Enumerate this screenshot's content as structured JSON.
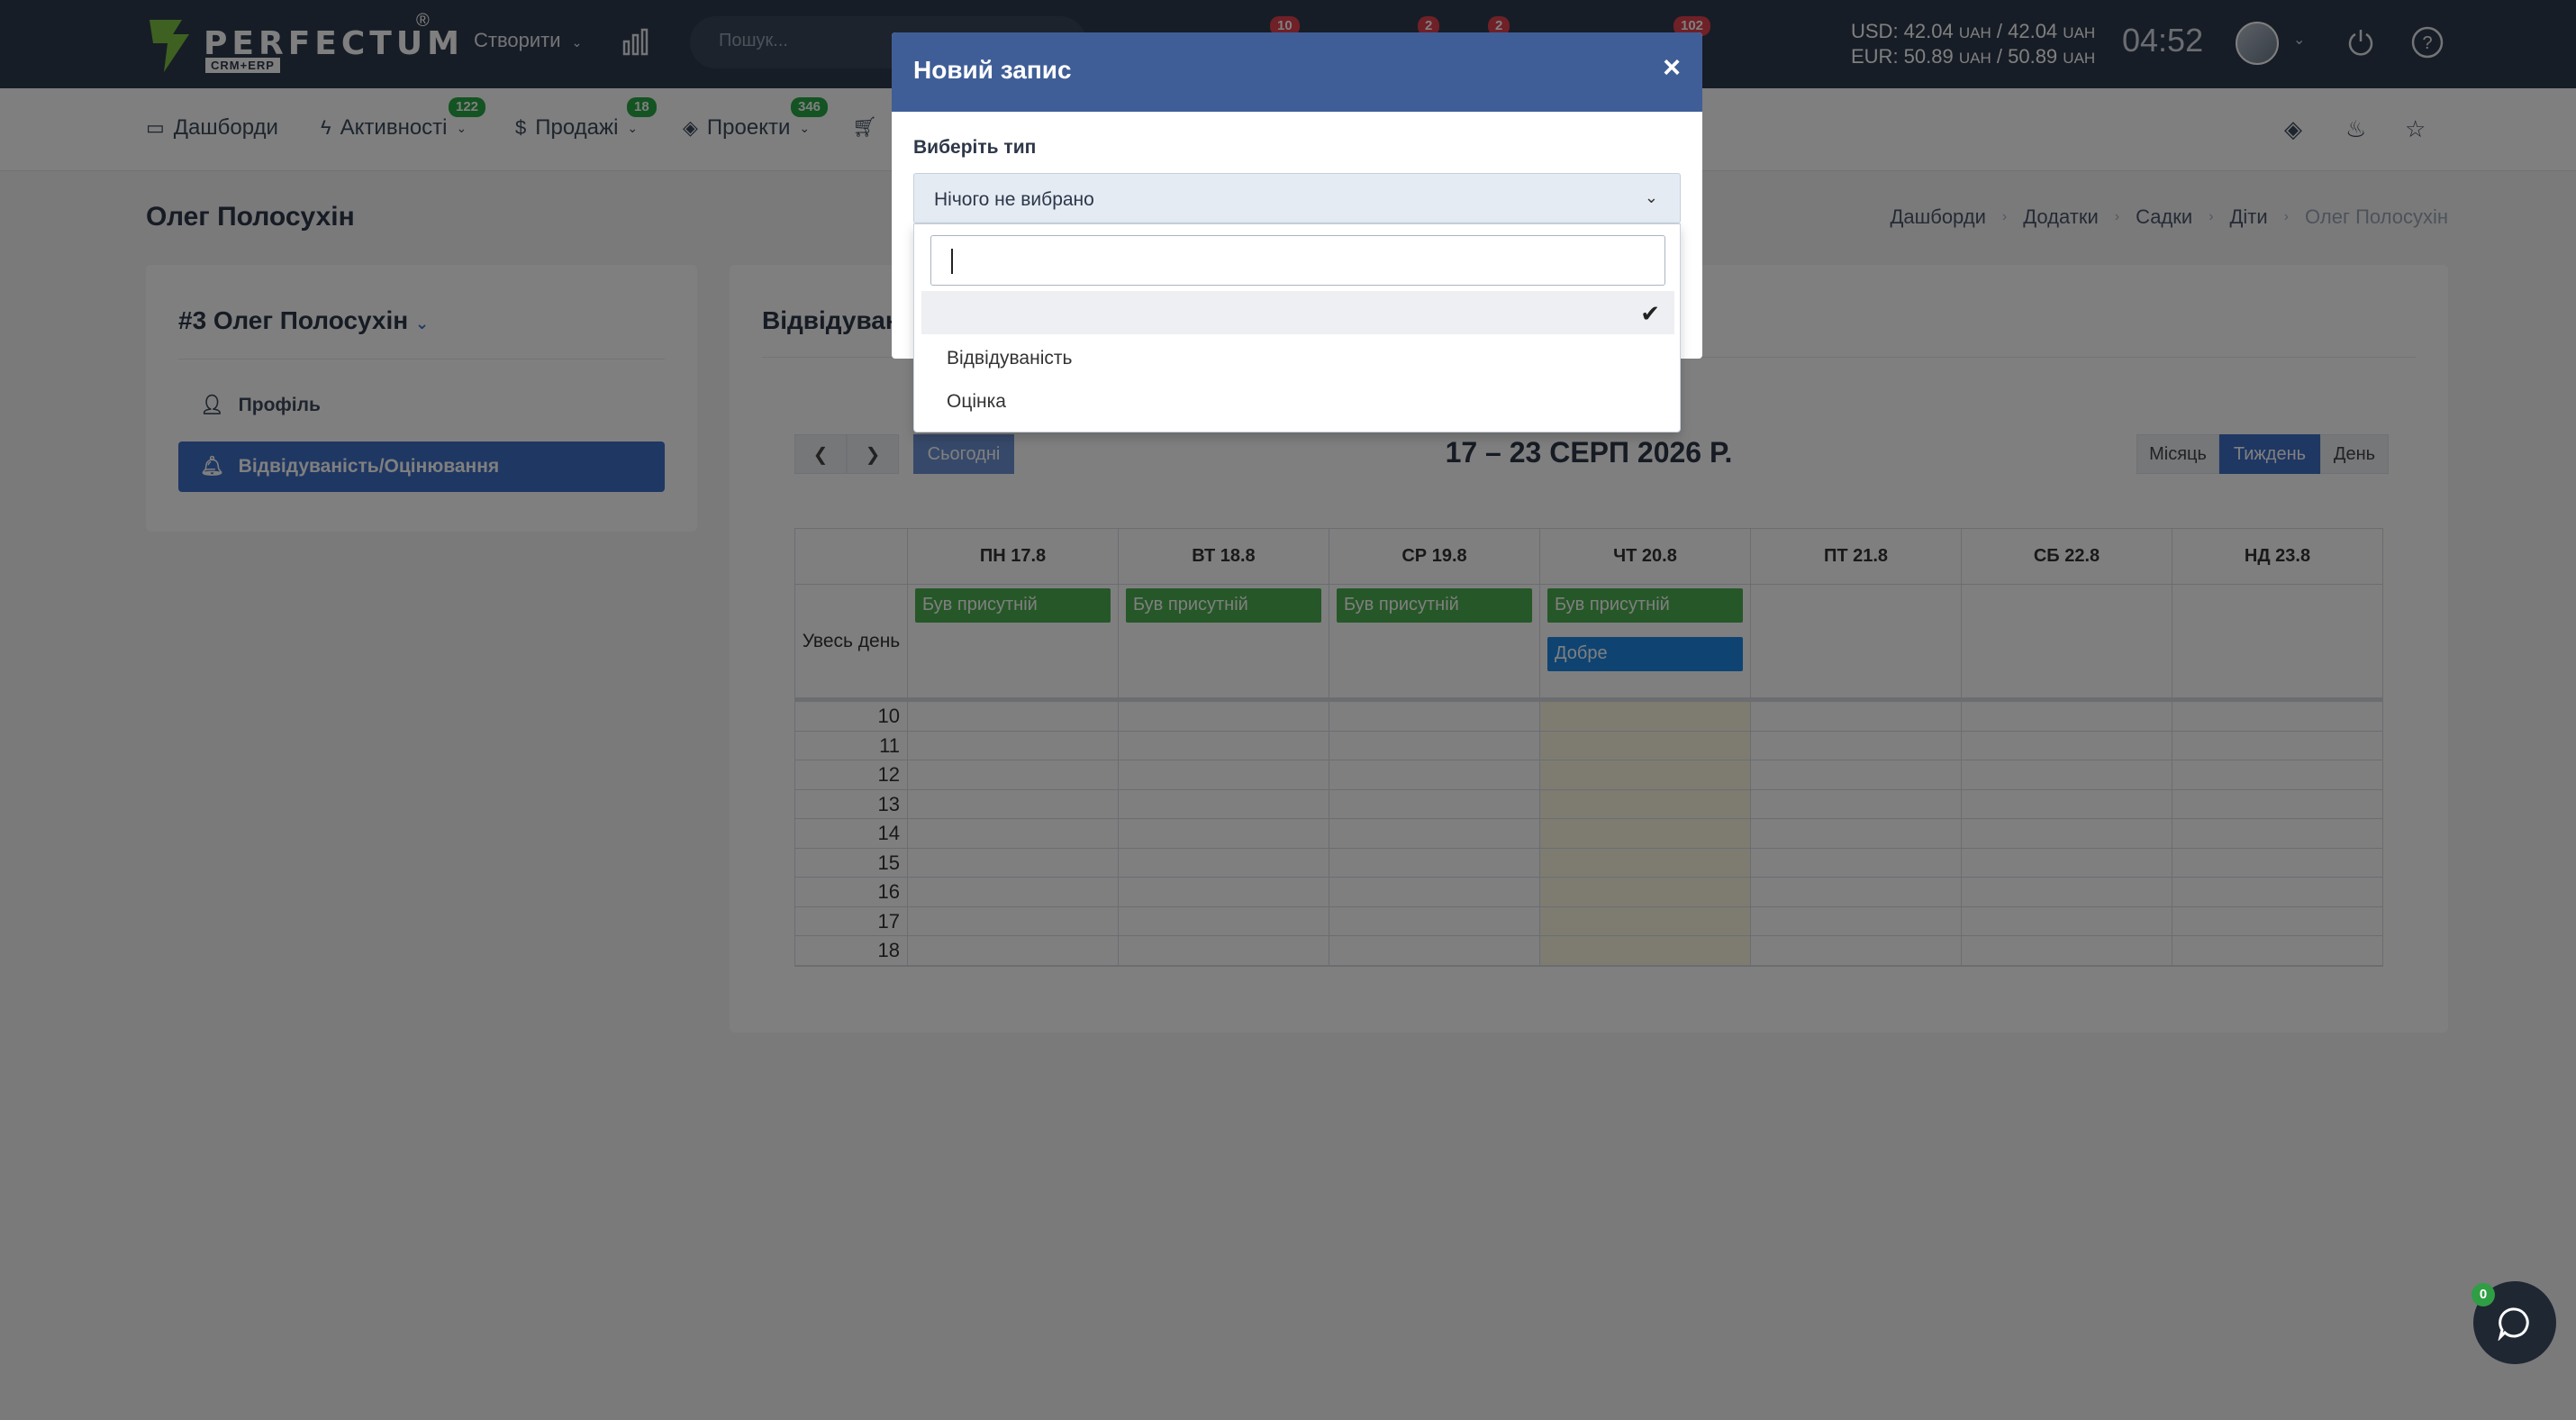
{
  "header": {
    "logo_text": "PERFECTUM",
    "logo_sub": "CRM+ERP",
    "logo_reg": "®",
    "create_label": "Створити",
    "search_placeholder": "Пошук...",
    "badges": [
      "10",
      "2",
      "2",
      "102"
    ],
    "currency_usd": "USD: 42.04",
    "currency_usd_mid": "/ 42.04",
    "currency_eur": "EUR: 50.89",
    "currency_eur_mid": "/ 50.89",
    "currency_unit": "UAH",
    "clock": "04:52"
  },
  "menu": {
    "items": [
      {
        "label": "Дашборди",
        "icon": "monitor-icon",
        "badge": ""
      },
      {
        "label": "Активності",
        "icon": "bolt-icon",
        "badge": "122"
      },
      {
        "label": "Продажі",
        "icon": "dollar-icon",
        "badge": "18"
      },
      {
        "label": "Проекти",
        "icon": "layers-icon",
        "badge": "346"
      }
    ]
  },
  "page": {
    "title": "Олег Полосухін",
    "breadcrumbs": [
      "Дашборди",
      "Додатки",
      "Садки",
      "Діти",
      "Олег Полосухін"
    ]
  },
  "left_card": {
    "heading": "#3 Олег Полосухін",
    "links": [
      "Профіль",
      "Відвідуваність/Оцінювання"
    ]
  },
  "right_card": {
    "heading": "Відвідувані",
    "today_label": "Сьогодні",
    "range_title": "17 – 23 СЕРП 2026 Р.",
    "views": [
      "Місяць",
      "Тиждень",
      "День"
    ],
    "days": [
      "ПН 17.8",
      "ВТ 18.8",
      "СР 19.8",
      "ЧТ 20.8",
      "ПТ 21.8",
      "СБ 22.8",
      "НД 23.8"
    ],
    "allday_label": "Увесь день",
    "events": [
      {
        "day": 0,
        "row": 0,
        "title": "Був присутній",
        "color": "#4caf50"
      },
      {
        "day": 1,
        "row": 0,
        "title": "Був присутній",
        "color": "#4caf50"
      },
      {
        "day": 2,
        "row": 0,
        "title": "Був присутній",
        "color": "#4caf50"
      },
      {
        "day": 3,
        "row": 0,
        "title": "Був присутній",
        "color": "#4caf50"
      },
      {
        "day": 3,
        "row": 1,
        "title": "Добре",
        "color": "#1e88e5"
      }
    ],
    "hours": [
      "10",
      "11",
      "12",
      "13",
      "14",
      "15",
      "16",
      "17",
      "18"
    ]
  },
  "modal": {
    "title": "Новий запис",
    "close": "×",
    "field_label": "Виберіть тип",
    "selected_value": "Нічого не вибрано",
    "options": [
      "",
      "Відвідуваність",
      "Оцінка"
    ],
    "selected_check": "✔"
  },
  "chat": {
    "badge": "0"
  },
  "colors": {
    "accent": "#3f6fc6",
    "modal_header": "#3f5e97",
    "topbar": "#2e3a4d"
  }
}
